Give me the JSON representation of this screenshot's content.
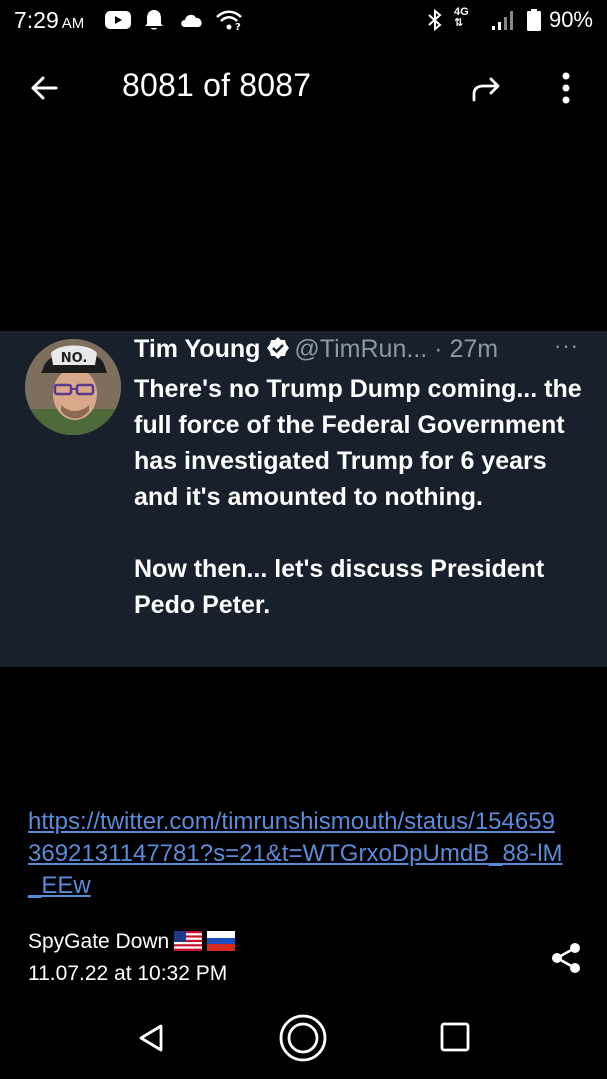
{
  "status_bar": {
    "time": "7:29",
    "ampm": "AM",
    "network": "4G",
    "battery": "90%",
    "icons": [
      "youtube-icon",
      "notification-bell-icon",
      "cloud-icon",
      "wifi-question-icon",
      "bluetooth-icon",
      "network-4g-icon",
      "signal-icon",
      "battery-icon"
    ]
  },
  "app_bar": {
    "title": "8081 of 8087",
    "icons": [
      "back-arrow-icon",
      "forward-share-icon",
      "overflow-menu-icon"
    ]
  },
  "tweet": {
    "name": "Tim Young",
    "handle": "@TimRun...",
    "time": "· 27m",
    "more": "···",
    "avatar_cap_text": "NO.",
    "body_lines": [
      "There's no Trump Dump coming... the full force of the Federal Government has investigated Trump for 6 years and it's amounted to nothing.",
      "Now then... let's discuss President Pedo Peter."
    ],
    "colors": {
      "background": "#17202b",
      "handle": "#8b98a5"
    }
  },
  "message": {
    "link": "https://twitter.com/timrunshismouth/status/1546593692131147781?s=21&t=WTGrxoDpUmdB_88-lM_EEw",
    "sender": "SpyGate Down",
    "timestamp": "11.07.22 at 10:32 PM",
    "link_color": "#5b8bd9"
  },
  "nav_bar": {
    "icons": [
      "nav-back-icon",
      "nav-home-icon",
      "nav-recents-icon"
    ]
  }
}
